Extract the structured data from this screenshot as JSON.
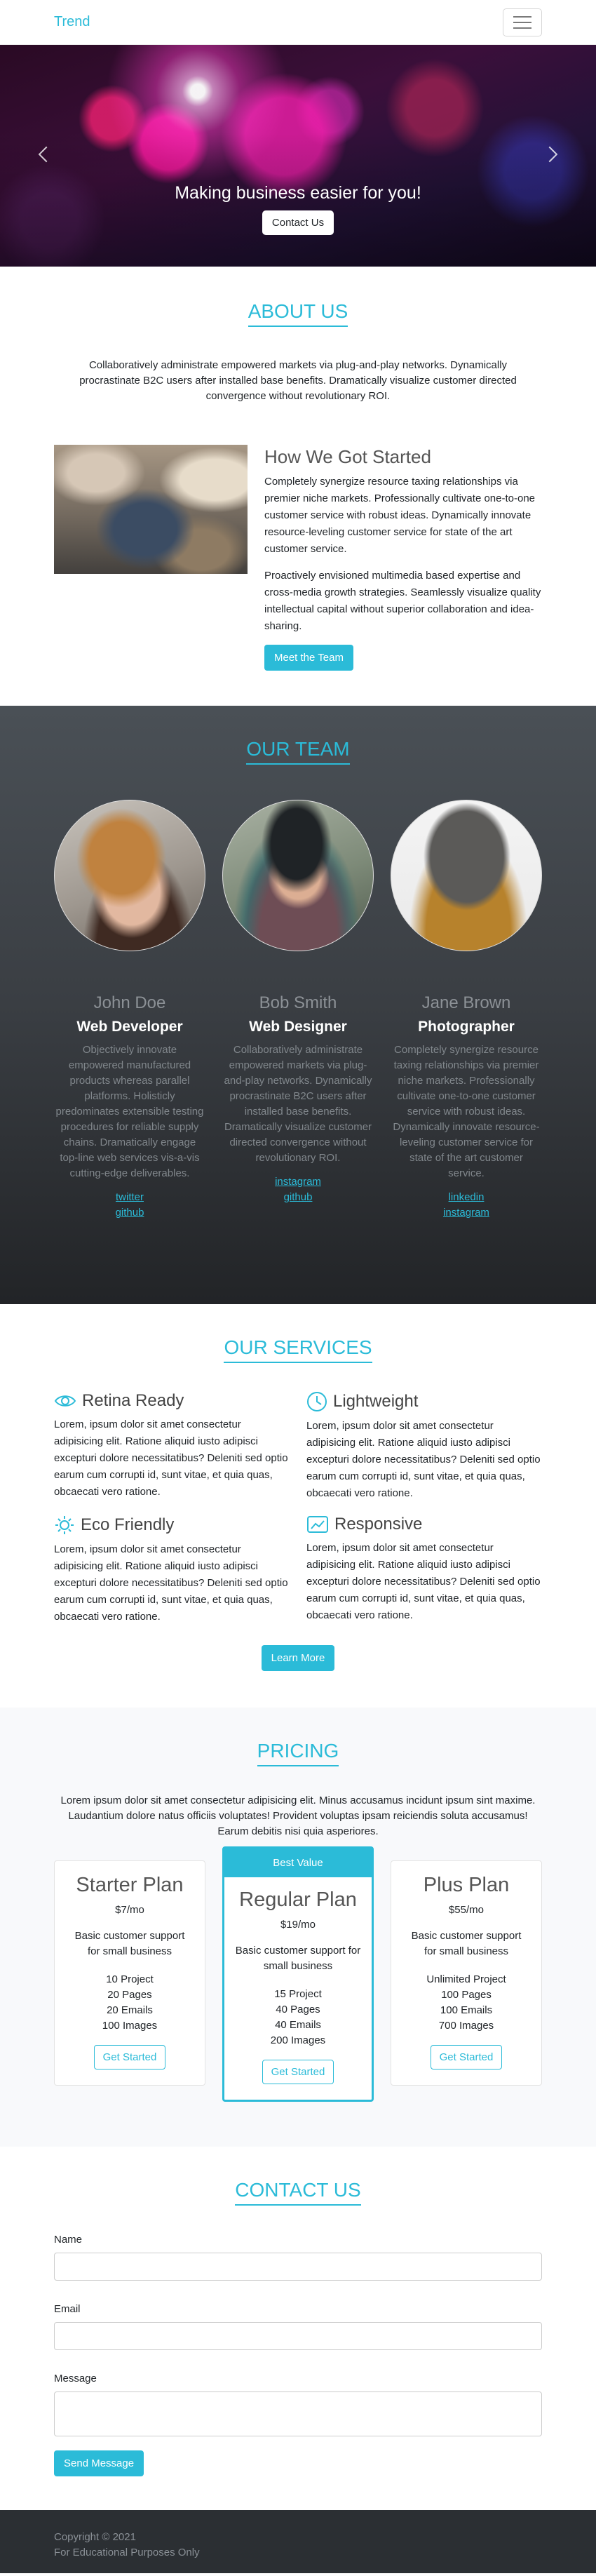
{
  "nav": {
    "brand": "Trend"
  },
  "hero": {
    "headline": "Making business easier for you!",
    "cta": "Contact Us"
  },
  "about": {
    "title": "ABOUT US",
    "intro": "Collaboratively administrate empowered markets via plug-and-play networks. Dynamically procrastinate B2C users after installed base benefits. Dramatically visualize customer directed convergence without revolutionary ROI.",
    "heading": "How We Got Started",
    "p1": "Completely synergize resource taxing relationships via premier niche markets. Professionally cultivate one-to-one customer service with robust ideas. Dynamically innovate resource-leveling customer service for state of the art customer service.",
    "p2": "Proactively envisioned multimedia based expertise and cross-media growth strategies. Seamlessly visualize quality intellectual capital without superior collaboration and idea-sharing.",
    "cta": "Meet the Team"
  },
  "team": {
    "title": "OUR TEAM",
    "members": [
      {
        "name": "John Doe",
        "role": "Web Developer",
        "bio": "Objectively innovate empowered manufactured products whereas parallel platforms. Holisticly predominates extensible testing procedures for reliable supply chains. Dramatically engage top-line web services vis-a-vis cutting-edge deliverables.",
        "links": [
          "twitter",
          "github"
        ]
      },
      {
        "name": "Bob Smith",
        "role": "Web Designer",
        "bio": "Collaboratively administrate empowered markets via plug-and-play networks. Dynamically procrastinate B2C users after installed base benefits. Dramatically visualize customer directed convergence without revolutionary ROI.",
        "links": [
          "instagram",
          "github"
        ]
      },
      {
        "name": "Jane Brown",
        "role": "Photographer",
        "bio": "Completely synergize resource taxing relationships via premier niche markets. Professionally cultivate one-to-one customer service with robust ideas. Dynamically innovate resource-leveling customer service for state of the art customer service.",
        "links": [
          "linkedin",
          "instagram"
        ]
      }
    ]
  },
  "services": {
    "title": "OUR SERVICES",
    "items": [
      {
        "title": "Retina Ready",
        "icon": "eye-icon",
        "text": "Lorem, ipsum dolor sit amet consectetur adipisicing elit. Ratione aliquid iusto adipisci excepturi dolore necessitatibus? Deleniti sed optio earum cum corrupti id, sunt vitae, et quia quas, obcaecati vero ratione."
      },
      {
        "title": "Lightweight",
        "icon": "clock-icon",
        "text": "Lorem, ipsum dolor sit amet consectetur adipisicing elit. Ratione aliquid iusto adipisci excepturi dolore necessitatibus? Deleniti sed optio earum cum corrupti id, sunt vitae, et quia quas, obcaecati vero ratione."
      },
      {
        "title": "Eco Friendly",
        "icon": "sun-icon",
        "text": "Lorem, ipsum dolor sit amet consectetur adipisicing elit. Ratione aliquid iusto adipisci excepturi dolore necessitatibus? Deleniti sed optio earum cum corrupti id, sunt vitae, et quia quas, obcaecati vero ratione."
      },
      {
        "title": "Responsive",
        "icon": "tablet-icon",
        "text": "Lorem, ipsum dolor sit amet consectetur adipisicing elit. Ratione aliquid iusto adipisci excepturi dolore necessitatibus? Deleniti sed optio earum cum corrupti id, sunt vitae, et quia quas, obcaecati vero ratione."
      }
    ],
    "cta": "Learn More"
  },
  "pricing": {
    "title": "PRICING",
    "intro": "Lorem ipsum dolor sit amet consectetur adipisicing elit. Minus accusamus incidunt ipsum sint maxime. Laudantium dolore natus officiis voluptates! Provident voluptas ipsam reiciendis soluta accusamus! Earum debitis nisi quia asperiores.",
    "plans": [
      {
        "name": "Starter Plan",
        "price": "$7/mo",
        "desc": "Basic customer support for small business",
        "features": [
          "10 Project",
          "20 Pages",
          "20 Emails",
          "100 Images"
        ],
        "cta": "Get Started"
      },
      {
        "badge": "Best Value",
        "name": "Regular Plan",
        "price": "$19/mo",
        "desc": "Basic customer support for small business",
        "features": [
          "15 Project",
          "40 Pages",
          "40 Emails",
          "200 Images"
        ],
        "cta": "Get Started"
      },
      {
        "name": "Plus Plan",
        "price": "$55/mo",
        "desc": "Basic customer support for small business",
        "features": [
          "Unlimited Project",
          "100 Pages",
          "100 Emails",
          "700 Images"
        ],
        "cta": "Get Started"
      }
    ]
  },
  "contact": {
    "title": "CONTACT US",
    "name_label": "Name",
    "email_label": "Email",
    "message_label": "Message",
    "submit": "Send Message"
  },
  "footer": {
    "copyright": "Copyright © 2021",
    "note": "For Educational Purposes Only"
  },
  "colors": {
    "accent": "#2bbbd8",
    "dark": "#2b2f33"
  }
}
